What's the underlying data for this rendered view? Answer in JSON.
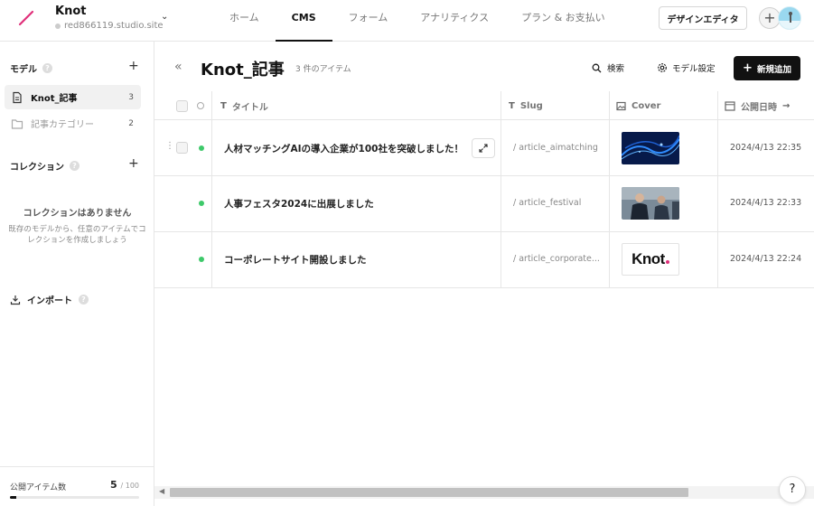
{
  "site": {
    "name": "Knot",
    "url": "red866119.studio.site"
  },
  "nav": {
    "tabs": [
      {
        "label": "ホーム"
      },
      {
        "label": "CMS"
      },
      {
        "label": "フォーム"
      },
      {
        "label": "アナリティクス"
      },
      {
        "label": "プラン & お支払い"
      }
    ],
    "active_tab": "CMS",
    "design_editor_label": "デザインエディタ",
    "add_label": "+"
  },
  "sidebar": {
    "models_label": "モデル",
    "models": [
      {
        "label": "Knot_記事",
        "count": "3",
        "icon": "document-icon"
      },
      {
        "label": "記事カテゴリー",
        "count": "2",
        "icon": "folder-icon"
      }
    ],
    "collections_label": "コレクション",
    "empty_title": "コレクションはありません",
    "empty_desc": "既存のモデルから、任意のアイテムでコレクションを作成しましょう",
    "import_label": "インポート",
    "publish_label": "公開アイテム数",
    "publish_count": "5",
    "publish_limit": "/ 100",
    "publish_fraction": 0.05
  },
  "main": {
    "title": "Knot_記事",
    "item_count": "3 件のアイテム",
    "search_label": "検索",
    "settings_label": "モデル設定",
    "add_label": "新規追加"
  },
  "table": {
    "columns": [
      {
        "label": "タイトル",
        "icon": "text-icon"
      },
      {
        "label": "Slug",
        "icon": "text-icon"
      },
      {
        "label": "Cover",
        "icon": "image-icon"
      },
      {
        "label": "公開日時",
        "icon": "calendar-icon"
      }
    ],
    "rows": [
      {
        "title": "人材マッチングAIの導入企業が100社を突破しました！",
        "slug": "/ article_aimatching",
        "cover": "blue-network-image",
        "date": "2024/4/13 22:35",
        "status": "published"
      },
      {
        "title": "人事フェスタ2024に出展しました",
        "slug": "/ article_festival",
        "cover": "business-people-image",
        "date": "2024/4/13 22:33",
        "status": "published"
      },
      {
        "title": "コーポレートサイト開設しました",
        "slug": "/ article_corporate...",
        "cover": "knot-logo-image",
        "cover_text": "Knot",
        "date": "2024/4/13 22:24",
        "status": "published"
      }
    ]
  },
  "colors": {
    "accent": "#111111",
    "status_green": "#3ec96a",
    "logo_pink": "#e0307a"
  },
  "help_label": "?"
}
